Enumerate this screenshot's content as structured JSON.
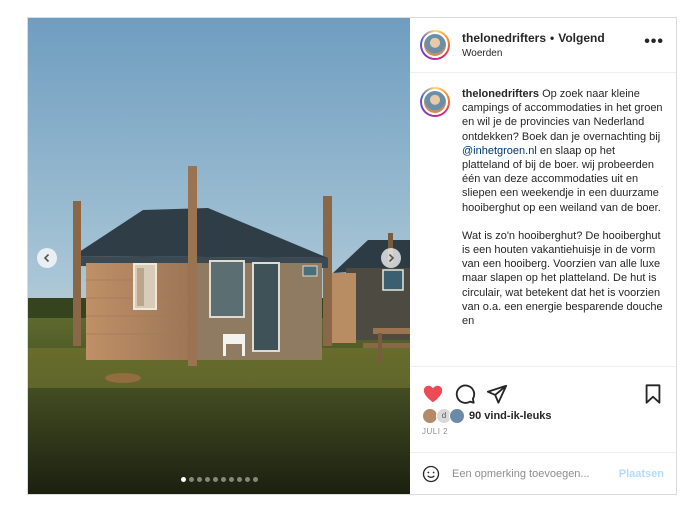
{
  "post": {
    "username": "thelonedrifters",
    "separator": "•",
    "follow_label": "Volgend",
    "location": "Woerden",
    "more_label": "•••",
    "caption_paragraph_1_before": "Op zoek naar kleine campings of accommodaties in het groen en wil je de provincies van Nederland ontdekken? Boek dan je overnachting bij ",
    "caption_mention": "@inhetgroen.nl",
    "caption_paragraph_1_after": " en slaap op het platteland of bij de boer. wij probeerden één van deze accommodaties uit en sliepen een weekendje in een duurzame hooiberghut op een weiland van de boer.",
    "caption_paragraph_2": "Wat is zo'n hooiberghut? De hooiberghut is een houten vakantiehuisje in de vorm van een hooiberg. Voorzien van alle luxe maar slapen op het platteland. De hut is circulair, wat betekent dat het is voorzien van o.a. een energie besparende douche en",
    "likes_label": "90 vind-ik-leuks",
    "date_label": "JULI 2",
    "liker_initial": "d",
    "carousel": {
      "total_slides": 10,
      "active_slide": 1
    }
  },
  "comment": {
    "placeholder": "Een opmerking toevoegen...",
    "post_label": "Plaatsen"
  },
  "icons": {
    "like": "heart-filled-icon",
    "comment": "comment-icon",
    "share": "share-icon",
    "save": "bookmark-icon",
    "emoji": "emoji-icon",
    "prev": "chevron-left-icon",
    "next": "chevron-right-icon"
  },
  "colors": {
    "like_red": "#ed4956",
    "mention_blue": "#00376b",
    "post_button_disabled": "#b3dbff"
  }
}
